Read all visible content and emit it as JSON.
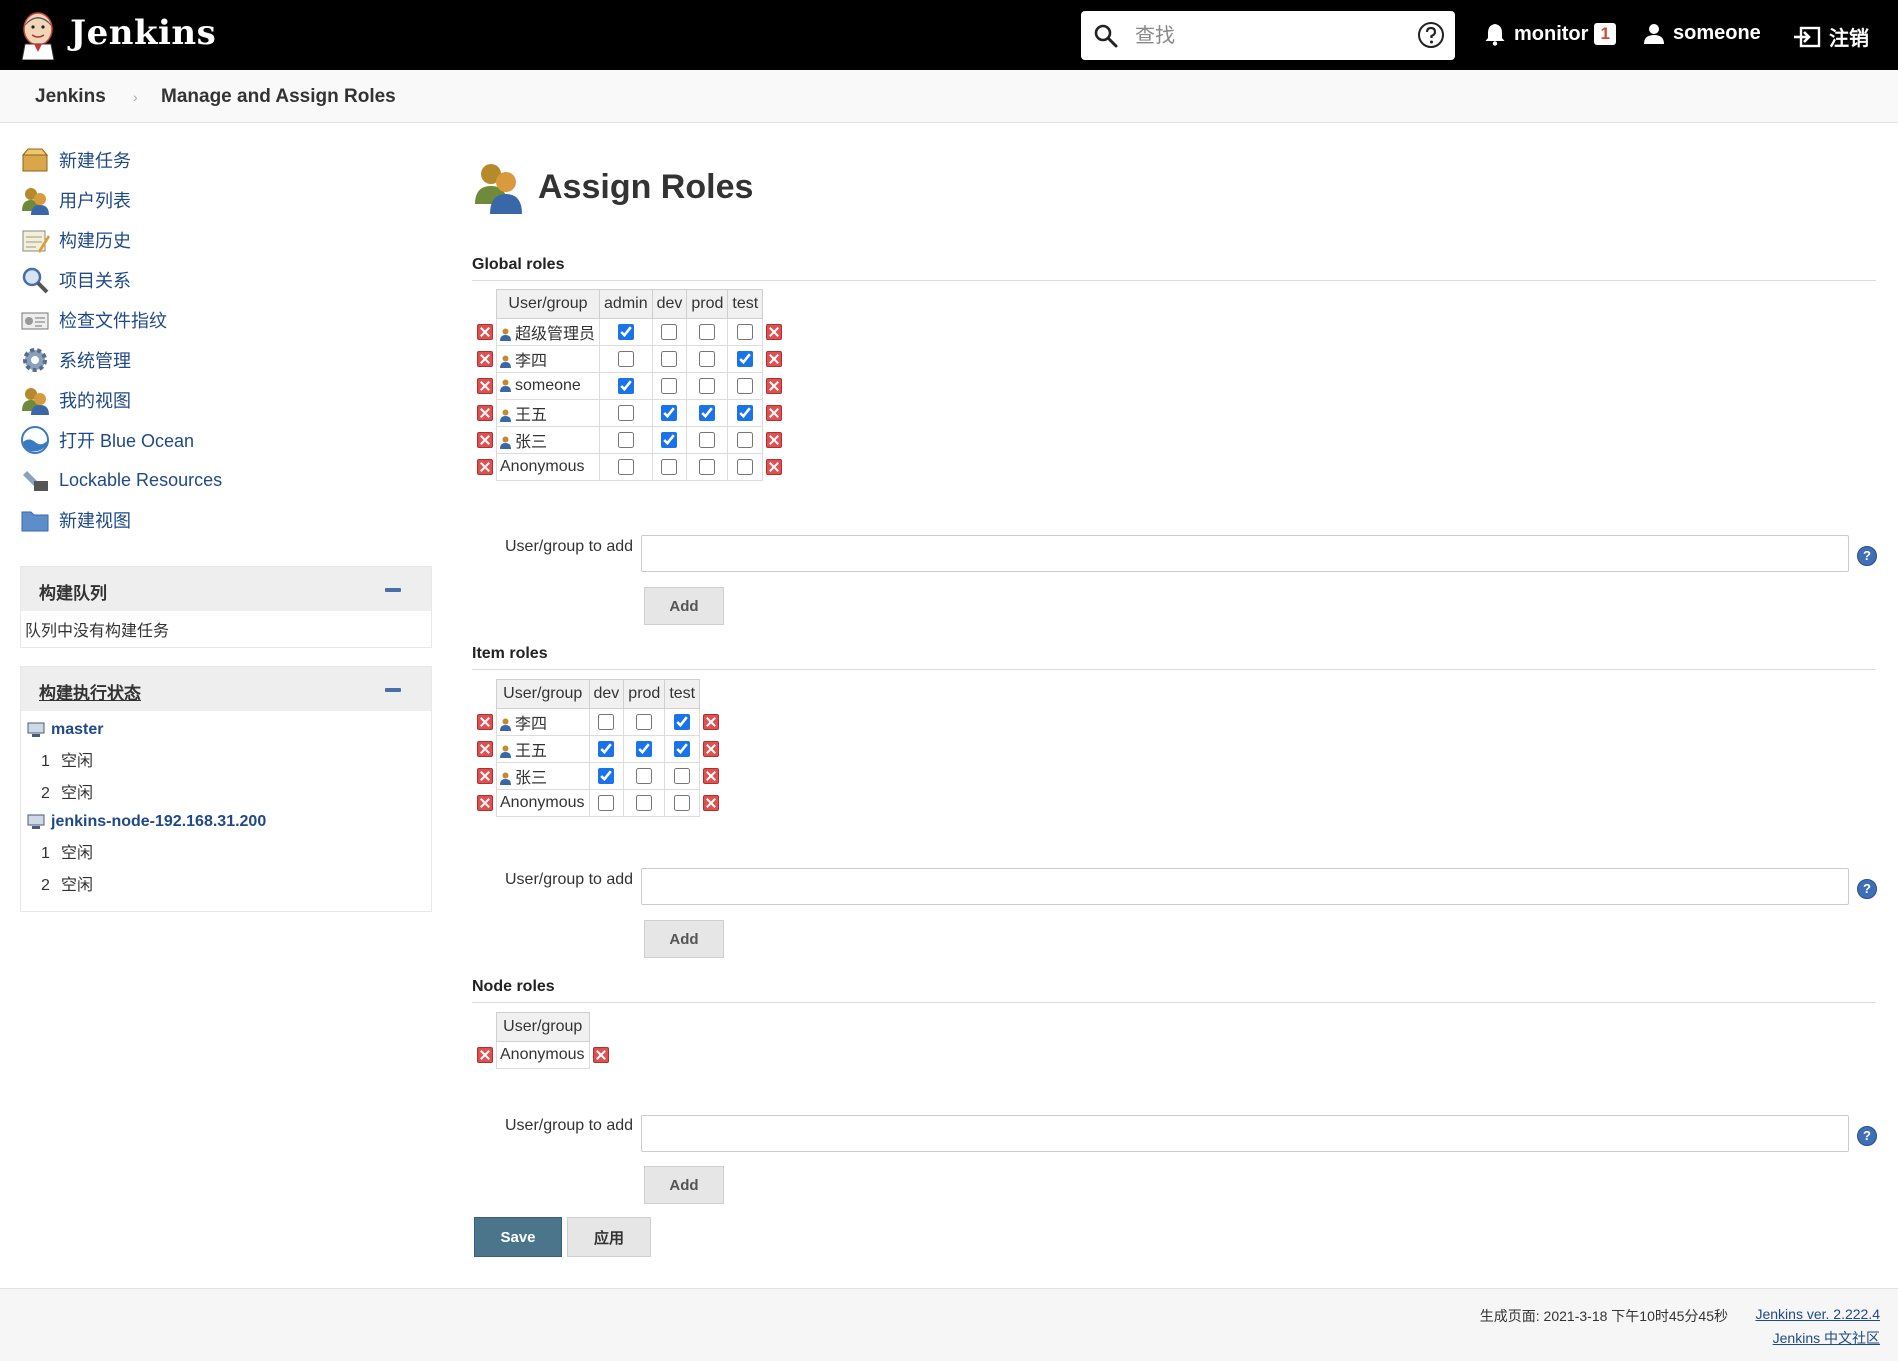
{
  "header": {
    "app_name": "Jenkins",
    "search_placeholder": "查找",
    "monitor_label": "monitor",
    "monitor_count": "1",
    "user_label": "someone",
    "logout_label": "注销"
  },
  "breadcrumb": {
    "root": "Jenkins",
    "current": "Manage and Assign Roles"
  },
  "sidebar": {
    "tasks": [
      {
        "label": "新建任务",
        "icon": "new-item-icon"
      },
      {
        "label": "用户列表",
        "icon": "users-icon"
      },
      {
        "label": "构建历史",
        "icon": "build-history-icon"
      },
      {
        "label": "项目关系",
        "icon": "magnifier-icon"
      },
      {
        "label": "检查文件指纹",
        "icon": "fingerprint-icon"
      },
      {
        "label": "系统管理",
        "icon": "gear-icon"
      },
      {
        "label": "我的视图",
        "icon": "my-views-icon"
      },
      {
        "label": "打开 Blue Ocean",
        "icon": "blue-ocean-icon"
      },
      {
        "label": "Lockable Resources",
        "icon": "lockable-resources-icon"
      },
      {
        "label": "新建视图",
        "icon": "folder-icon"
      }
    ],
    "build_queue": {
      "title": "构建队列",
      "empty_text": "队列中没有构建任务"
    },
    "executors": {
      "title": "构建执行状态",
      "nodes": [
        {
          "name": "master",
          "slots": [
            {
              "num": "1",
              "status": "空闲"
            },
            {
              "num": "2",
              "status": "空闲"
            }
          ]
        },
        {
          "name": "jenkins-node-192.168.31.200",
          "slots": [
            {
              "num": "1",
              "status": "空闲"
            },
            {
              "num": "2",
              "status": "空闲"
            }
          ]
        }
      ]
    }
  },
  "main": {
    "title": "Assign Roles",
    "global_roles": {
      "heading": "Global roles",
      "user_group_header": "User/group",
      "columns": [
        "admin",
        "dev",
        "prod",
        "test"
      ],
      "rows": [
        {
          "name": "超级管理员",
          "user": true,
          "checks": [
            true,
            false,
            false,
            false
          ]
        },
        {
          "name": "李四",
          "user": true,
          "checks": [
            false,
            false,
            false,
            true
          ]
        },
        {
          "name": "someone",
          "user": true,
          "checks": [
            true,
            false,
            false,
            false
          ]
        },
        {
          "name": "王五",
          "user": true,
          "checks": [
            false,
            true,
            true,
            true
          ]
        },
        {
          "name": "张三",
          "user": true,
          "checks": [
            false,
            true,
            false,
            false
          ]
        },
        {
          "name": "Anonymous",
          "user": false,
          "checks": [
            false,
            false,
            false,
            false
          ]
        }
      ]
    },
    "item_roles": {
      "heading": "Item roles",
      "user_group_header": "User/group",
      "columns": [
        "dev",
        "prod",
        "test"
      ],
      "rows": [
        {
          "name": "李四",
          "user": true,
          "checks": [
            false,
            false,
            true
          ]
        },
        {
          "name": "王五",
          "user": true,
          "checks": [
            true,
            true,
            true
          ]
        },
        {
          "name": "张三",
          "user": true,
          "checks": [
            true,
            false,
            false
          ]
        },
        {
          "name": "Anonymous",
          "user": false,
          "checks": [
            false,
            false,
            false
          ]
        }
      ]
    },
    "node_roles": {
      "heading": "Node roles",
      "user_group_header": "User/group",
      "columns": [],
      "rows": [
        {
          "name": "Anonymous",
          "user": false,
          "checks": []
        }
      ]
    },
    "add_label": "User/group to add",
    "add_button": "Add",
    "save_button": "Save",
    "apply_button": "应用"
  },
  "footer": {
    "generated": "生成页面: 2021-3-18 下午10时45分45秒",
    "version_link": "Jenkins ver. 2.222.4",
    "community_link": "Jenkins 中文社区"
  },
  "colors": {
    "header_bg": "#000000",
    "link": "#204a87",
    "save_button": "#4b758b"
  }
}
